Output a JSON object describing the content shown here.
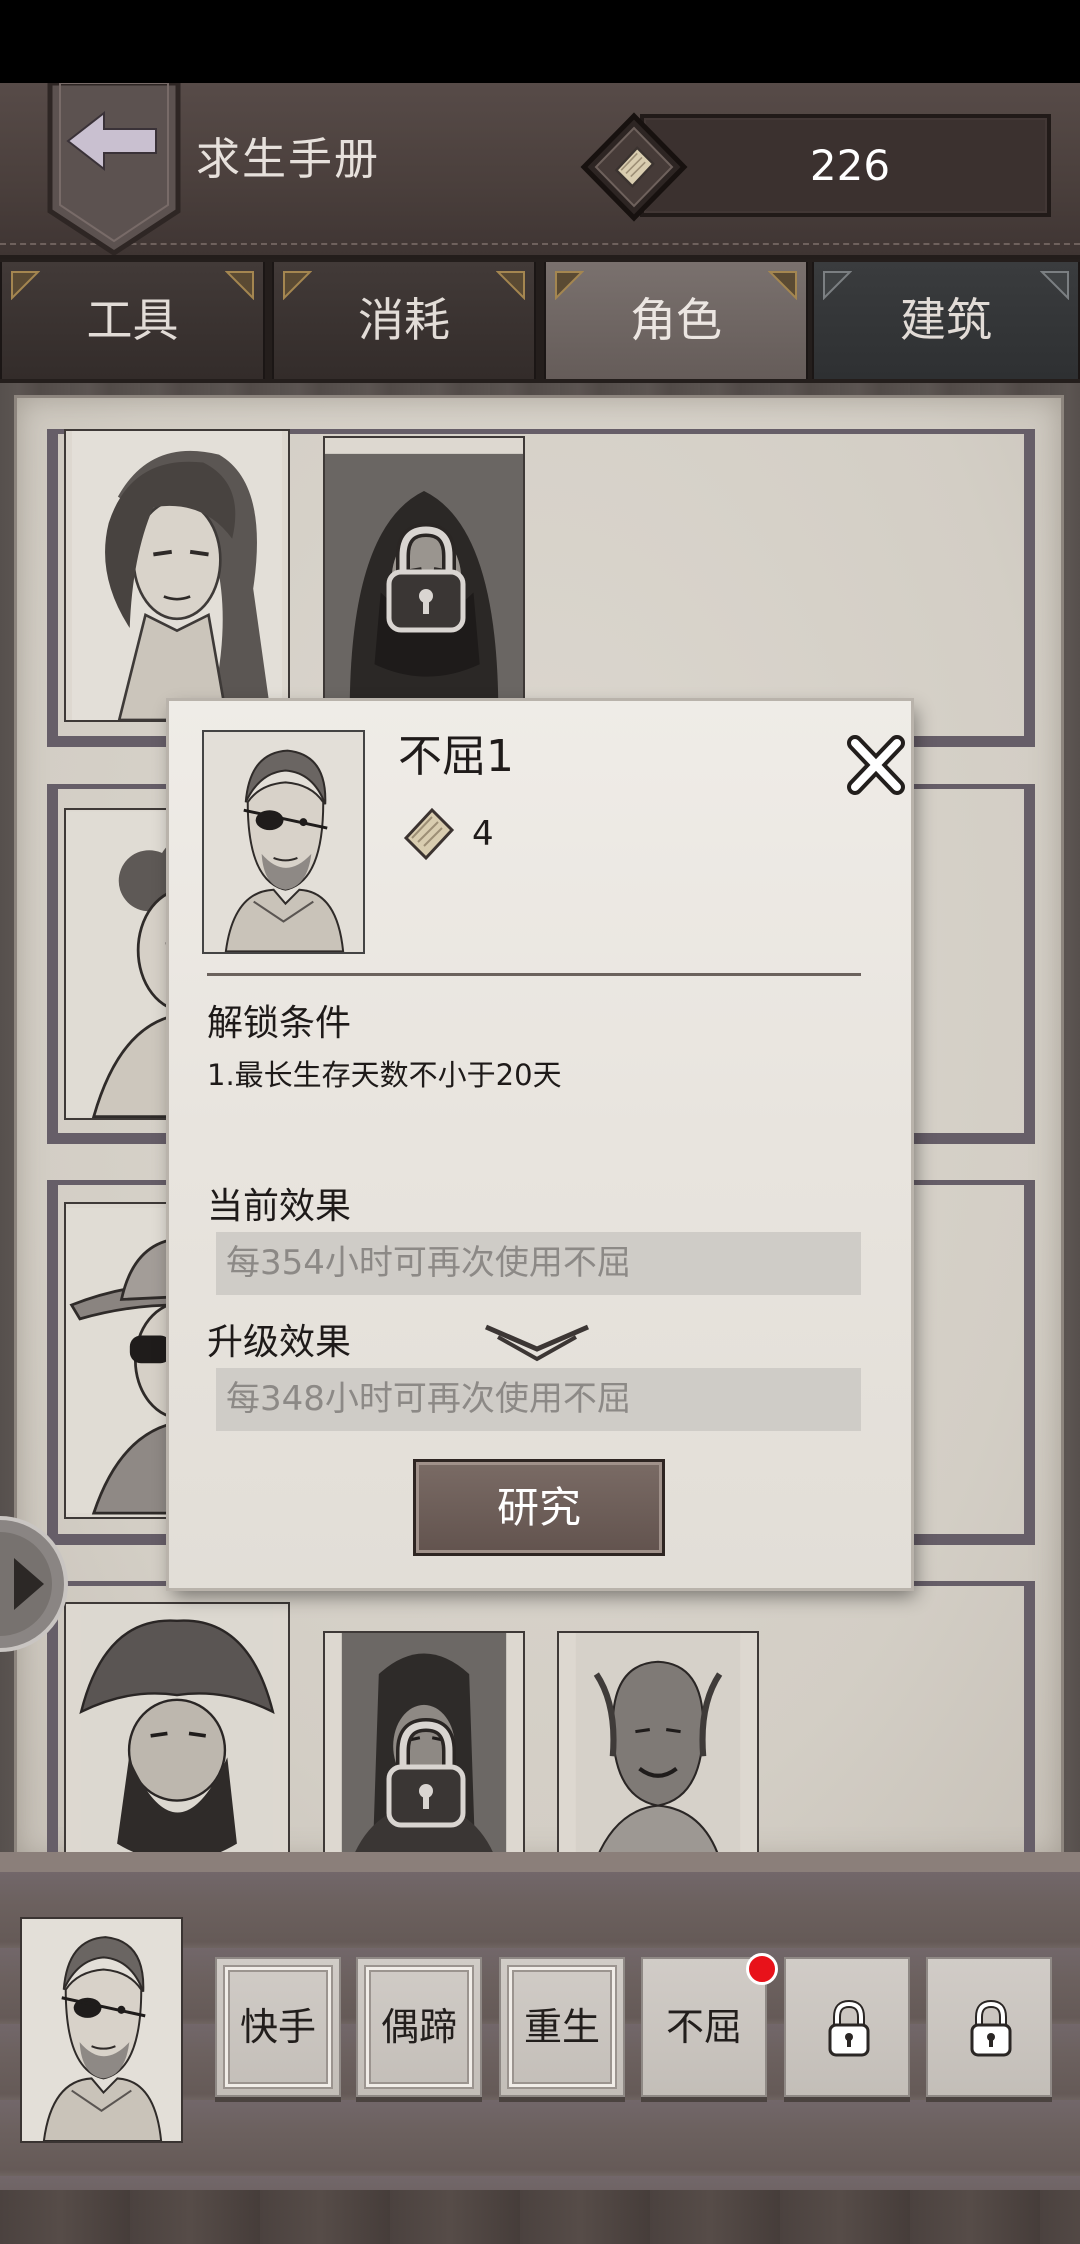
{
  "header": {
    "back_icon": "back-arrow-icon",
    "title": "求生手册",
    "currency_icon": "manual-page-icon",
    "currency_value": "226"
  },
  "tabs": [
    {
      "label": "工具",
      "active": false
    },
    {
      "label": "消耗",
      "active": false
    },
    {
      "label": "角色",
      "active": true
    },
    {
      "label": "建筑",
      "active": false
    }
  ],
  "character_grid": {
    "rows": [
      [
        {
          "locked": false
        },
        {
          "locked": true
        }
      ],
      [
        {
          "locked": false
        }
      ],
      [
        {
          "locked": false
        }
      ],
      [
        {
          "locked": false
        },
        {
          "locked": true
        },
        {
          "locked": false
        }
      ]
    ],
    "lock_icon": "lock-icon"
  },
  "side_arrow_icon": "arrow-right-icon",
  "modal": {
    "name": "不屈1",
    "cost_icon": "manual-page-icon",
    "cost": "4",
    "close_icon": "close-icon",
    "unlock_title": "解锁条件",
    "unlock_conditions": [
      "1.最长生存天数不小于20天"
    ],
    "current_effect_title": "当前效果",
    "current_effect": "每354小时可再次使用不屈",
    "upgrade_effect_title": "升级效果",
    "upgrade_indicator_icon": "chevron-down-icon",
    "upgrade_effect": "每348小时可再次使用不屈",
    "research_button": "研究"
  },
  "skill_bar": {
    "skills": [
      {
        "label": "快手",
        "locked": false,
        "notification": false
      },
      {
        "label": "偶蹄",
        "locked": false,
        "notification": false
      },
      {
        "label": "重生",
        "locked": false,
        "notification": false
      },
      {
        "label": "不屈",
        "locked": false,
        "notification": true
      },
      {
        "locked": true,
        "icon": "lock-icon",
        "notification": false
      },
      {
        "locked": true,
        "icon": "lock-icon",
        "notification": false
      }
    ]
  },
  "colors": {
    "header_bg": "#4f4442",
    "tab_active": "#6d6461",
    "paper": "#d7d2ca",
    "modal_bg": "#ece9e4",
    "effect_box": "#cfccc7",
    "effect_text": "#8c8986",
    "button_bg": "#6b5c56",
    "notification_dot": "#e8121a"
  }
}
